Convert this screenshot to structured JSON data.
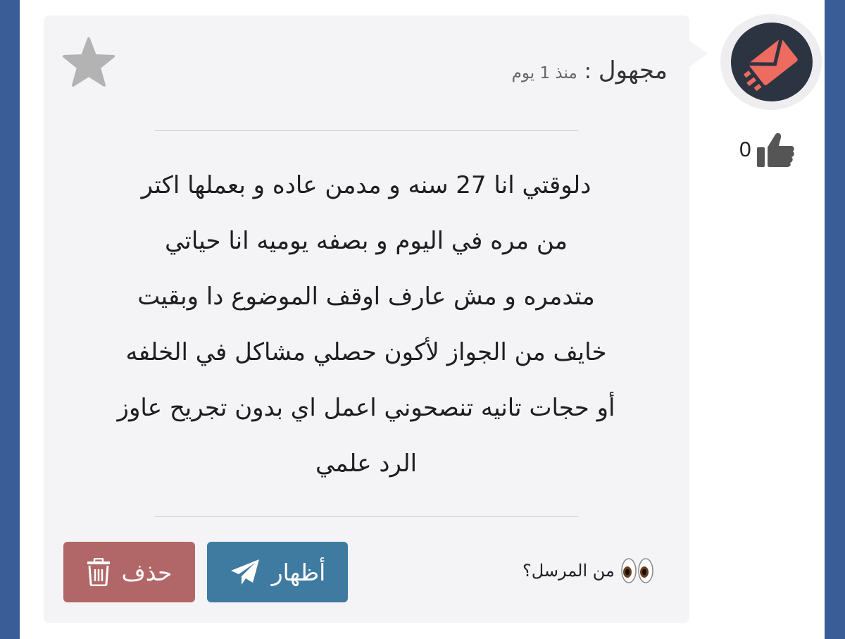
{
  "post": {
    "sender_name": "مجهول",
    "separator": ":",
    "time_ago": "منذ 1 يوم",
    "message_lines": [
      "دلوقتي انا 27 سنه و مدمن عاده و بعملها اكتر",
      "من مره في اليوم و بصفه يوميه انا حياتي",
      "متدمره و مش عارف اوقف الموضوع دا وبقيت",
      "خايف من الجواز لأكون حصلي مشاكل في الخلفه",
      "أو حجات تانيه تنصحوني اعمل اي بدون تجريح عاوز",
      "الرد علمي"
    ],
    "likes": "0",
    "who_sent_label": "من المرسل؟",
    "show_button_label": "أظهار",
    "delete_button_label": "حذف"
  },
  "icons": {
    "avatar": "envelope-icon",
    "like": "thumbs-up-icon",
    "favorite": "star-icon",
    "show": "paper-plane-icon",
    "delete": "trash-icon",
    "eyes": "eyes-emoji-icon"
  },
  "colors": {
    "page_background": "#3b5d97",
    "card_background": "#f4f4f6",
    "avatar_background": "#2c3441",
    "avatar_accent": "#ee6b5f",
    "show_button": "#3f7aa0",
    "delete_button": "#b16767",
    "star": "#b3b3b3"
  }
}
